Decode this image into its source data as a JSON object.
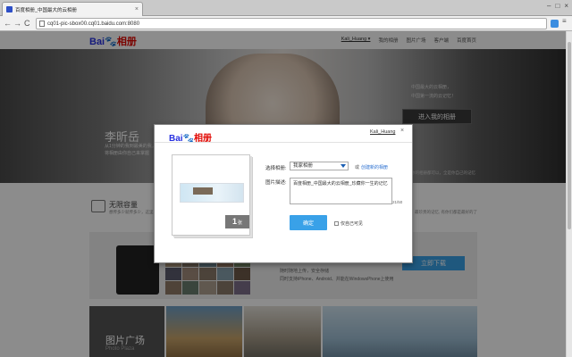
{
  "browser": {
    "tab_title": "百度相册_中国最大的云相册",
    "tab_close": "×",
    "url": "cq01-pic-sbox00.cq01.baidu.com:8080",
    "back": "←",
    "forward": "→",
    "reload": "C",
    "window_buttons": [
      "–",
      "□",
      "×"
    ]
  },
  "site": {
    "logo": {
      "bai": "Bai",
      "paw": "🐾",
      "ce": "相册"
    },
    "user_nav": [
      {
        "label": "Kali_Huang ▾"
      },
      {
        "label": "我的相册"
      },
      {
        "label": "图片广场"
      },
      {
        "label": "客户端"
      },
      {
        "label": "百度首页"
      }
    ]
  },
  "hero": {
    "name": "李昕岳",
    "desc": "从1分钟的我到最美的我，将相册由你自己来掌握",
    "side_text": [
      "中国最大的云相册，",
      "中国第一流的云记忆！"
    ],
    "enter_button": "进入我的相册",
    "note": "你的相册都可以，全是你自己的记忆"
  },
  "features": {
    "title": "无限容量",
    "text": "想传多少就传多少，这里就是你的空间",
    "right_text": "最珍贵的记忆, 有你们都是最好的了"
  },
  "mobile": {
    "lines": [
      "随时随地上传，安全存储",
      "同时支持iPhone、Android、并能在WindowsPhone上使用"
    ],
    "download_button": "立即下载"
  },
  "plaza": {
    "title": "图片广场",
    "subtitle": "Photo Plaza"
  },
  "dialog": {
    "logo": {
      "bai": "Bai",
      "paw": "🐾",
      "ce": "相册"
    },
    "username": "Kali_Huang",
    "close": "×",
    "count_number": "1",
    "count_unit": "张",
    "select_label": "选择相册:",
    "select_value": "我家相册",
    "or_text": "或",
    "create_link": "创建新的相册",
    "desc_label": "图片描述:",
    "desc_value": "百度相册_中国最大的云相册_珍藏你一生的记忆",
    "char_count": "21/50",
    "confirm_button": "确定",
    "checkbox_label": "仅自己可见"
  },
  "colors": {
    "brand_blue": "#2932e1",
    "brand_red": "#e10601",
    "button_blue": "#39a1e8"
  }
}
